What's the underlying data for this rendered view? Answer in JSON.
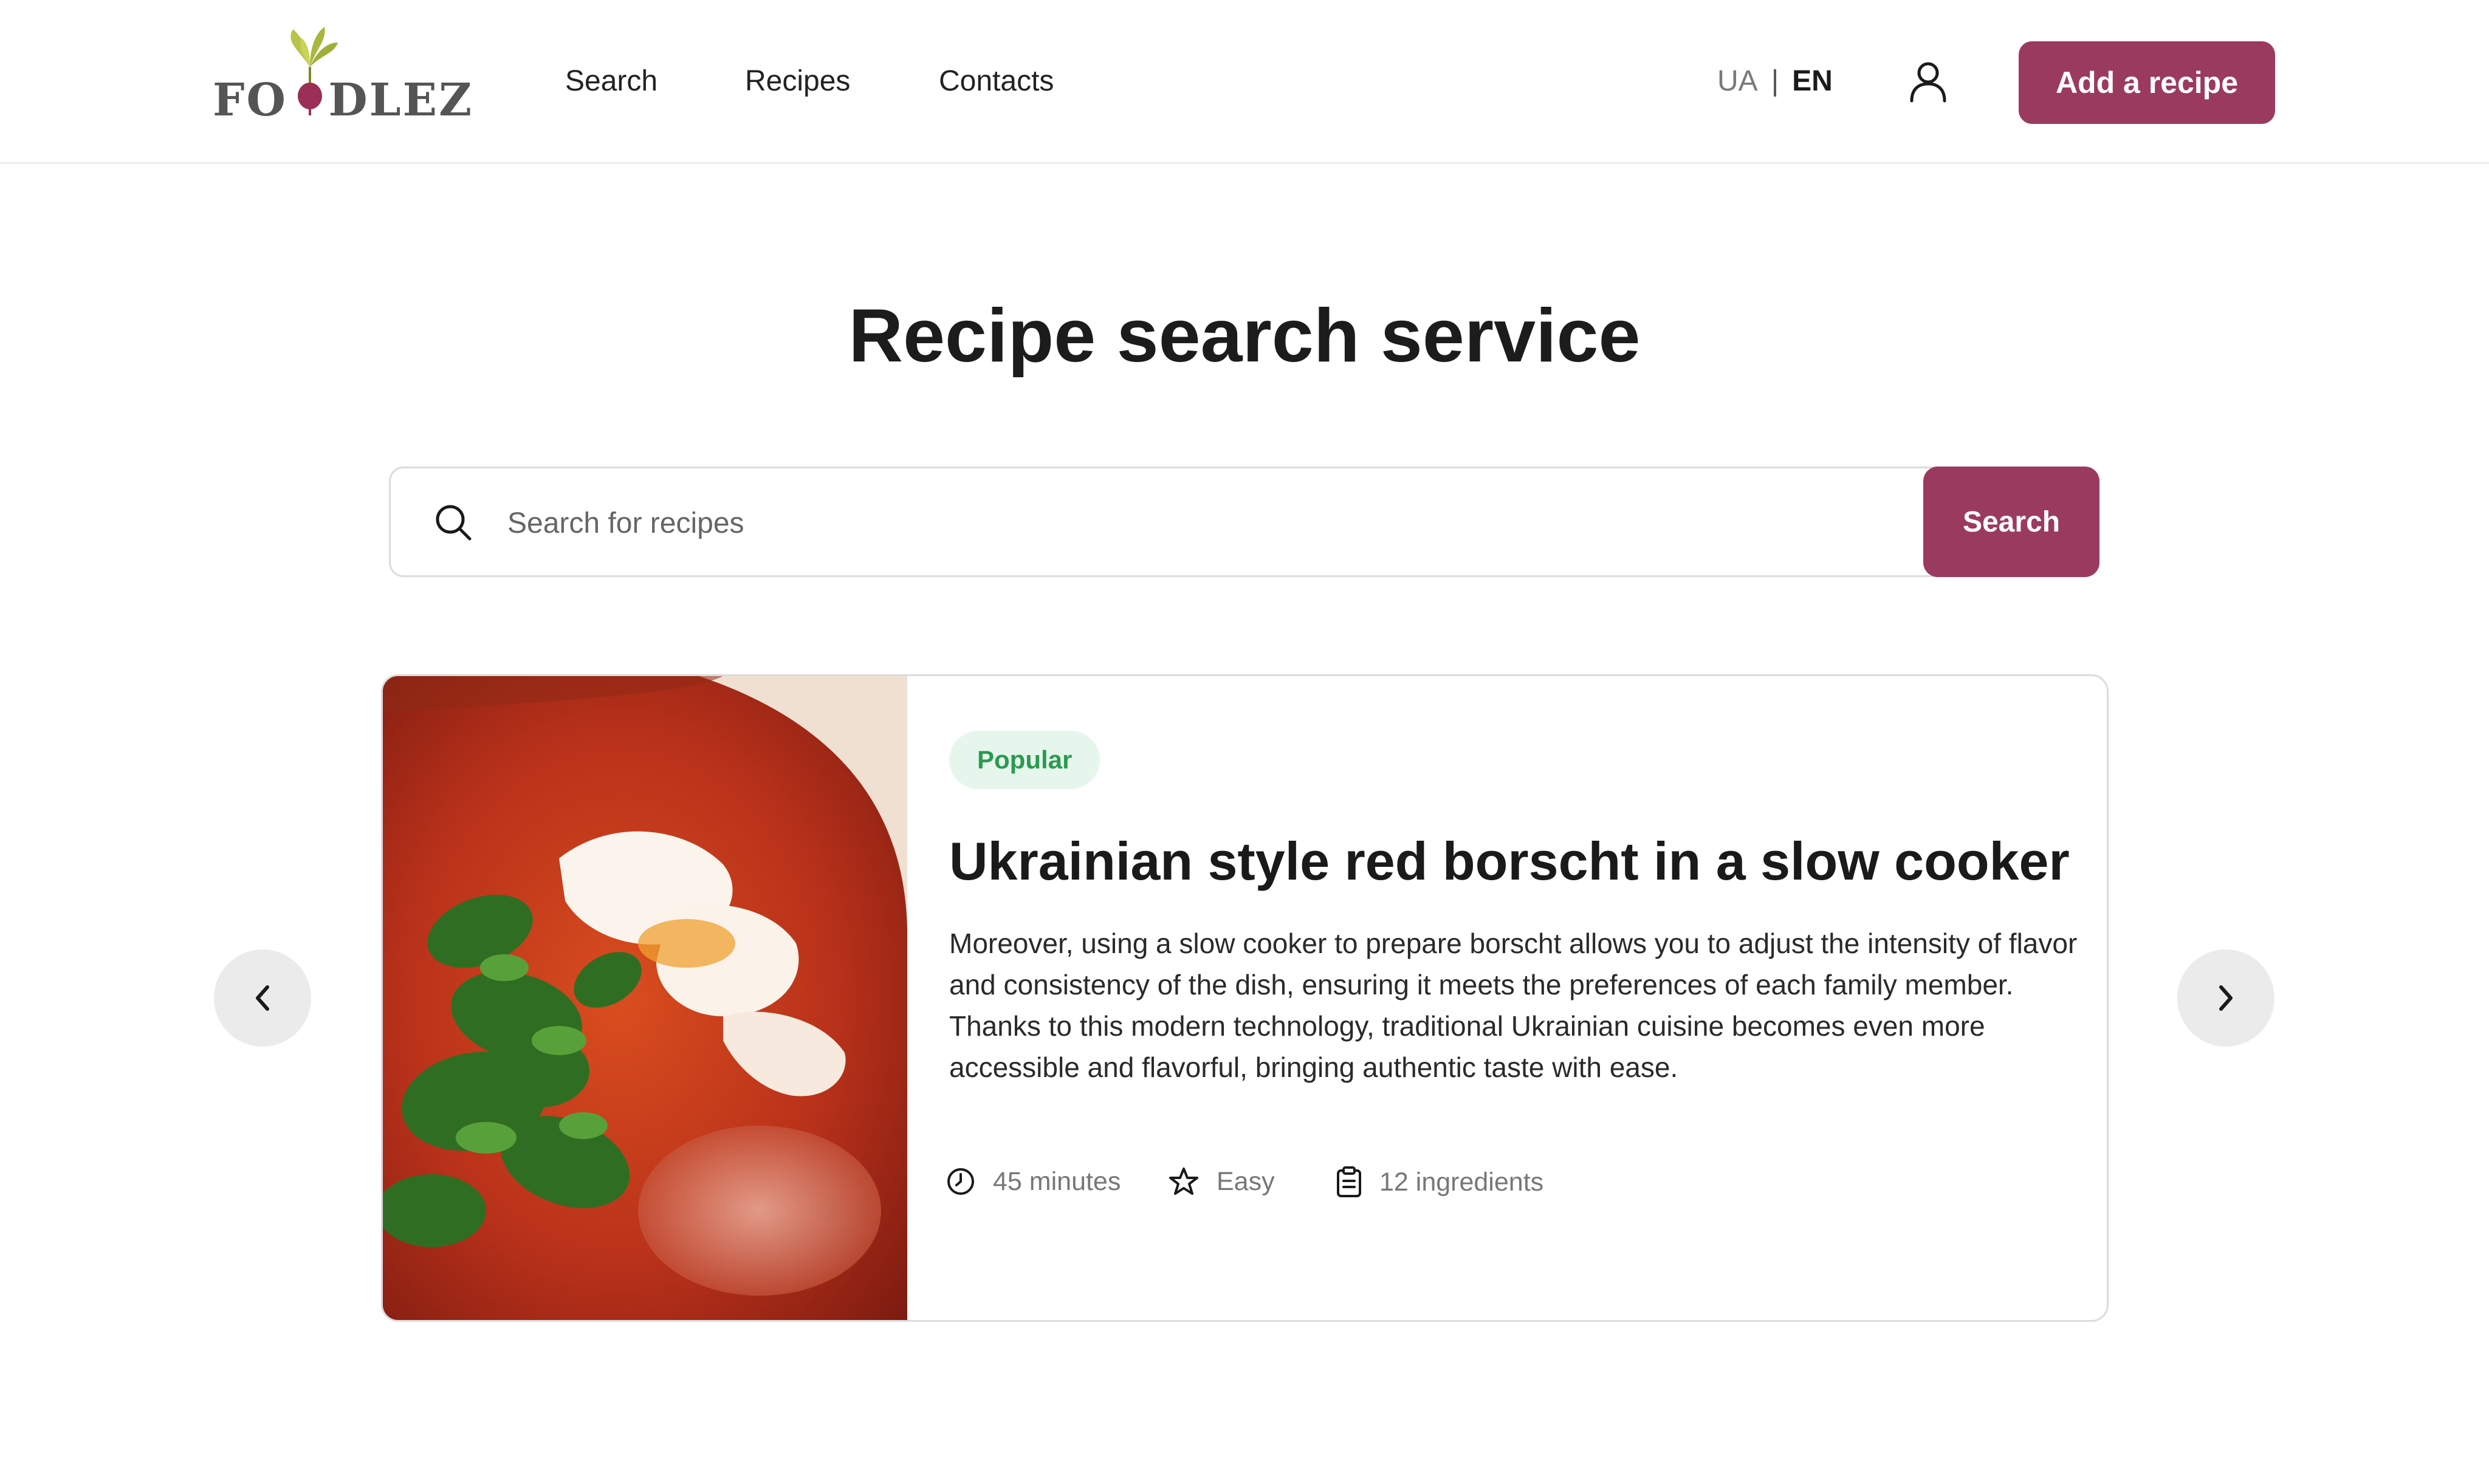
{
  "header": {
    "logo_text": "FOODLEZ",
    "nav": {
      "search": "Search",
      "recipes": "Recipes",
      "contacts": "Contacts"
    },
    "lang": {
      "ua": "UA",
      "separator": "|",
      "en": "EN",
      "active": "EN"
    },
    "user_icon": "user-icon",
    "add_recipe_label": "Add a recipe"
  },
  "hero": {
    "title": "Recipe search service"
  },
  "search": {
    "placeholder": "Search for recipes",
    "value": "",
    "button_label": "Search",
    "icon": "search-icon"
  },
  "carousel": {
    "prev_icon": "chevron-left-icon",
    "next_icon": "chevron-right-icon",
    "card": {
      "badge": "Popular",
      "title": "Ukrainian style red borscht in a slow cooker",
      "description": "Moreover, using a slow cooker to prepare borscht allows you to adjust the intensity of flavor and consistency of the dish, ensuring it meets the preferences of each family member. Thanks to this modern technology, traditional Ukrainian cuisine becomes even more accessible and flavorful, bringing authentic taste with ease.",
      "meta": {
        "time": "45 minutes",
        "difficulty": "Easy",
        "ingredients": "12 ingredients"
      }
    }
  },
  "colors": {
    "brand": "#9b3a5f",
    "badge_bg": "#e7f6ec",
    "badge_text": "#2a9a4f",
    "arrow_bg": "#ebebeb"
  }
}
